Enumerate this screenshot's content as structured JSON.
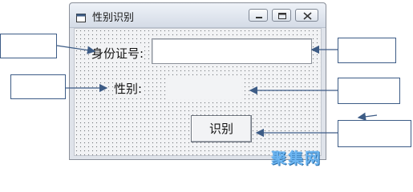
{
  "window": {
    "title": "性别识别",
    "colors": {
      "title_bar": "#d4dbe6",
      "client_background": "#f2f3f5",
      "grid_dots": "#6f7378"
    }
  },
  "form": {
    "id_label": "身份证号:",
    "id_input_value": "",
    "gender_label": "性别:",
    "gender_value": "",
    "recognize_button": "识别"
  },
  "annotations": {
    "border_color": "#3d5c86",
    "arrow_color": "#3d5c86",
    "boxes": [
      {
        "name": "annotation-box-id-label",
        "text": ""
      },
      {
        "name": "annotation-box-gender-label",
        "text": ""
      },
      {
        "name": "annotation-box-id-input",
        "text": ""
      },
      {
        "name": "annotation-box-gender-output",
        "text": ""
      },
      {
        "name": "annotation-box-recognize-button",
        "text": ""
      }
    ]
  },
  "watermark": {
    "text": "聚集网",
    "color": "#6db6f2"
  }
}
